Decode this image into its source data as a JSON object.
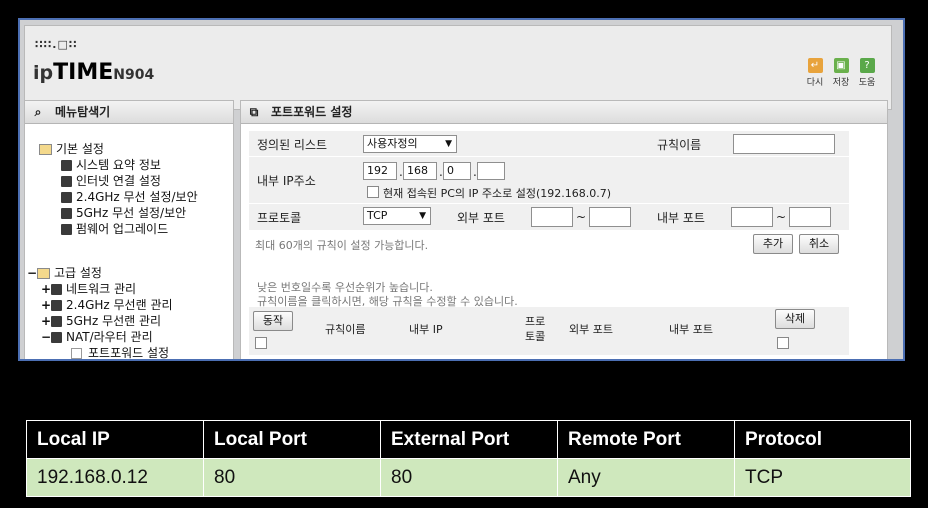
{
  "header": {
    "logo_dots": "∷∷.□∷",
    "logo_ip": "ip",
    "logo_time": "TIME",
    "model": "N904",
    "tools": [
      {
        "label": "다시",
        "icon": "refresh-icon",
        "color": "#e8a33c",
        "glyph": "↵"
      },
      {
        "label": "저장",
        "icon": "save-icon",
        "color": "#6ab04c",
        "glyph": "▣"
      },
      {
        "label": "도움",
        "icon": "help-icon",
        "color": "#5aa84a",
        "glyph": "?"
      }
    ]
  },
  "sidebar": {
    "title": "메뉴탐색기",
    "basic": {
      "label": "기본 설정",
      "items": [
        "시스템 요약 정보",
        "인터넷 연결 설정",
        "2.4GHz 무선 설정/보안",
        "5GHz 무선 설정/보안",
        "펌웨어 업그레이드"
      ]
    },
    "advanced": {
      "label": "고급 설정",
      "items": [
        "네트워크 관리",
        "2.4GHz 무선랜 관리",
        "5GHz 무선랜 관리",
        "NAT/라우터 관리"
      ],
      "sub_item": "포트포워드 설정"
    }
  },
  "main": {
    "title": "포트포워드 설정",
    "defined_list_label": "정의된 리스트",
    "defined_list_value": "사용자정의",
    "rule_name_label": "규칙이름",
    "rule_name_value": "",
    "internal_ip_label": "내부 IP주소",
    "ip_octets": [
      "192",
      "168",
      "0",
      ""
    ],
    "current_ip_label": "현재 접속된 PC의 IP 주소로 설정(192.168.0.7)",
    "protocol_label": "프로토콜",
    "protocol_value": "TCP",
    "external_port_label": "외부 포트",
    "internal_port_label": "내부 포트",
    "tilde": "~",
    "max_rules_note": "최대 60개의 규칙이 설정 가능합니다.",
    "add_label": "추가",
    "cancel_label": "취소",
    "priority_note": "낮은 번호일수록 우선순위가 높습니다.",
    "edit_note": "규칙이름을 클릭하시면, 해당 규칙을 수정할 수 있습니다.",
    "table_headers": {
      "action": "동작",
      "rule_name": "규칙이름",
      "internal_ip": "내부 IP",
      "protocol_line1": "프로",
      "protocol_line2": "토콜",
      "external_port": "외부 포트",
      "internal_port": "내부 포트",
      "delete": "삭제"
    }
  },
  "rule_table": {
    "headers": [
      "Local IP",
      "Local Port",
      "External Port",
      "Remote Port",
      "Protocol"
    ],
    "row": [
      "192.168.0.12",
      "80",
      "80",
      "Any",
      "TCP"
    ]
  }
}
